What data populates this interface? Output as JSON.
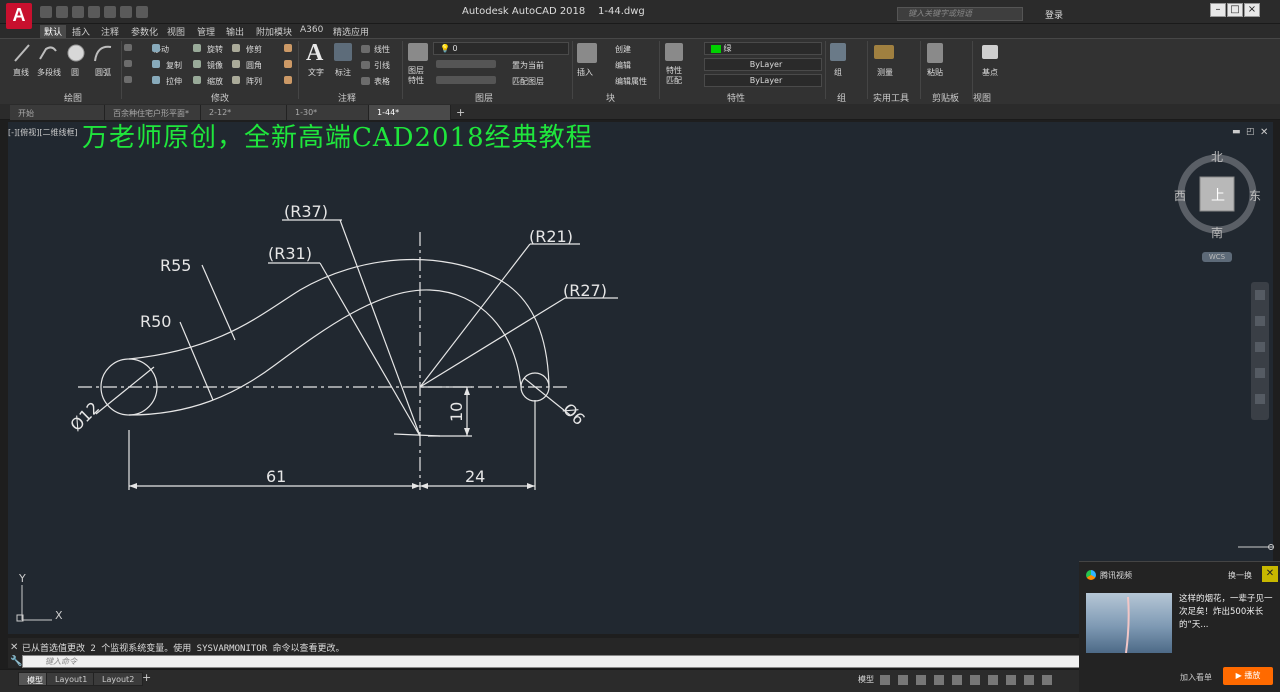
{
  "app": {
    "logo_letter": "A",
    "title": "Autodesk AutoCAD 2018",
    "filename": "1-44.dwg",
    "search_placeholder": "键入关键字或短语",
    "login_label": "登录",
    "help_label": "?"
  },
  "ribbon_tabs": [
    "默认",
    "插入",
    "注释",
    "参数化",
    "视图",
    "管理",
    "输出",
    "附加模块",
    "A360",
    "精选应用"
  ],
  "ribbon": {
    "draw": {
      "title": "绘图",
      "line": "直线",
      "polyline": "多段线",
      "circle": "圆",
      "arc": "圆弧"
    },
    "modify": {
      "title": "修改",
      "move": "移动",
      "rotate": "旋转",
      "trim": "修剪",
      "copy": "复制",
      "mirror": "镜像",
      "fillet": "圆角",
      "stretch": "拉伸",
      "scale": "缩放",
      "array": "阵列"
    },
    "annotation": {
      "title": "注释",
      "text": "文字",
      "dimension": "标注",
      "linear": "线性",
      "leader": "引线",
      "table": "表格"
    },
    "layers": {
      "title": "图层",
      "props": "图层\n特性",
      "current_layer": "0",
      "make_current": "置为当前",
      "match_layer": "匹配图层"
    },
    "block": {
      "title": "块",
      "insert": "插入",
      "create": "创建",
      "edit": "编辑",
      "edit_attr": "编辑属性"
    },
    "properties": {
      "title": "特性",
      "match": "特性\n匹配",
      "color": "绿",
      "linetype": "ByLayer",
      "lineweight": "ByLayer"
    },
    "groups": {
      "title": "组",
      "group": "组"
    },
    "utilities": {
      "title": "实用工具",
      "measure": "测量"
    },
    "clipboard": {
      "title": "剪贴板",
      "paste": "粘贴"
    },
    "view": {
      "title": "视图",
      "base": "基点"
    }
  },
  "file_tabs": [
    "开始",
    "百余种住宅户形平面*",
    "2-12*",
    "1-30*",
    "1-44*"
  ],
  "viewport_label": "[-][俯视][二维线框]",
  "watermark": "万老师原创，全新高端CAD2018经典教程",
  "drawing": {
    "labels": {
      "r37": "(R37)",
      "r31": "(R31)",
      "r21": "(R21)",
      "r27": "(R27)",
      "r55": "R55",
      "r50": "R50",
      "d12": "Ø12",
      "d6": "Ø6",
      "v10": "10",
      "h61": "61",
      "h24": "24"
    }
  },
  "navcube": {
    "north": "北",
    "south": "南",
    "east": "东",
    "west": "西",
    "face": "上",
    "wcs": "WCS"
  },
  "ucs": {
    "x": "X",
    "y": "Y"
  },
  "command": {
    "history": "已从首选值更改 2 个监视系统变量。使用 SYSVARMONITOR 命令以查看更改。",
    "placeholder": "键入命令"
  },
  "layout_tabs": [
    "模型",
    "Layout1",
    "Layout2"
  ],
  "status": {
    "model": "模型"
  },
  "popup": {
    "brand": "腾讯视频",
    "refresh": "换一换",
    "text": "这样的烟花，一辈子见一次足矣！炸出500米长的“天...",
    "add_list": "加入看单",
    "play": "播放"
  }
}
